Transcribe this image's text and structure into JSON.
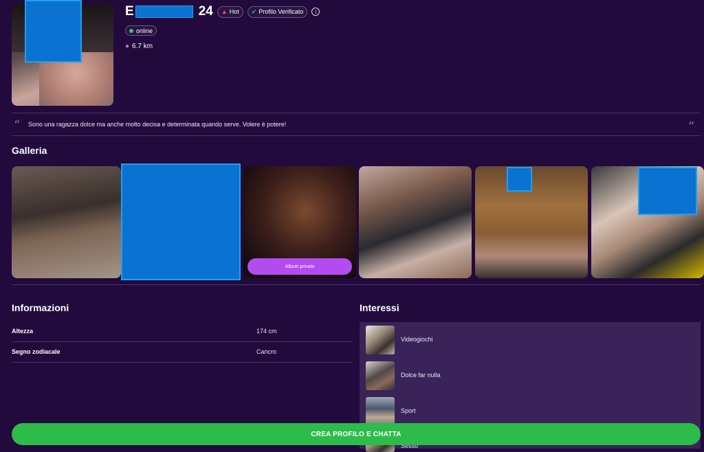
{
  "profile": {
    "name_initial": "E",
    "age": "24",
    "hot_label": "Hot",
    "verified_label": "Profilo Verificato",
    "status": "online",
    "distance": "6.7 km",
    "bio": "Sono una ragazza dolce ma anche molto decisa e determinata quando serve. Volere è potere!"
  },
  "gallery": {
    "title": "Galleria",
    "private_album_label": "Album privato"
  },
  "info": {
    "title": "Informazioni",
    "rows": [
      {
        "label": "Altezza",
        "value": "174 cm"
      },
      {
        "label": "Segno zodiacale",
        "value": "Cancro"
      }
    ]
  },
  "interests": {
    "title": "Interessi",
    "items": [
      {
        "label": "Videogiochi"
      },
      {
        "label": "Dolce far nulla"
      },
      {
        "label": "Sport"
      },
      {
        "label": "Sesso"
      }
    ]
  },
  "cta": {
    "label": "CREA PROFILO E CHATTA"
  },
  "colors": {
    "background": "#230a3d",
    "accent_purple": "#b24cf0",
    "cta_green": "#2dbc4a",
    "online_green": "#33c46b"
  }
}
